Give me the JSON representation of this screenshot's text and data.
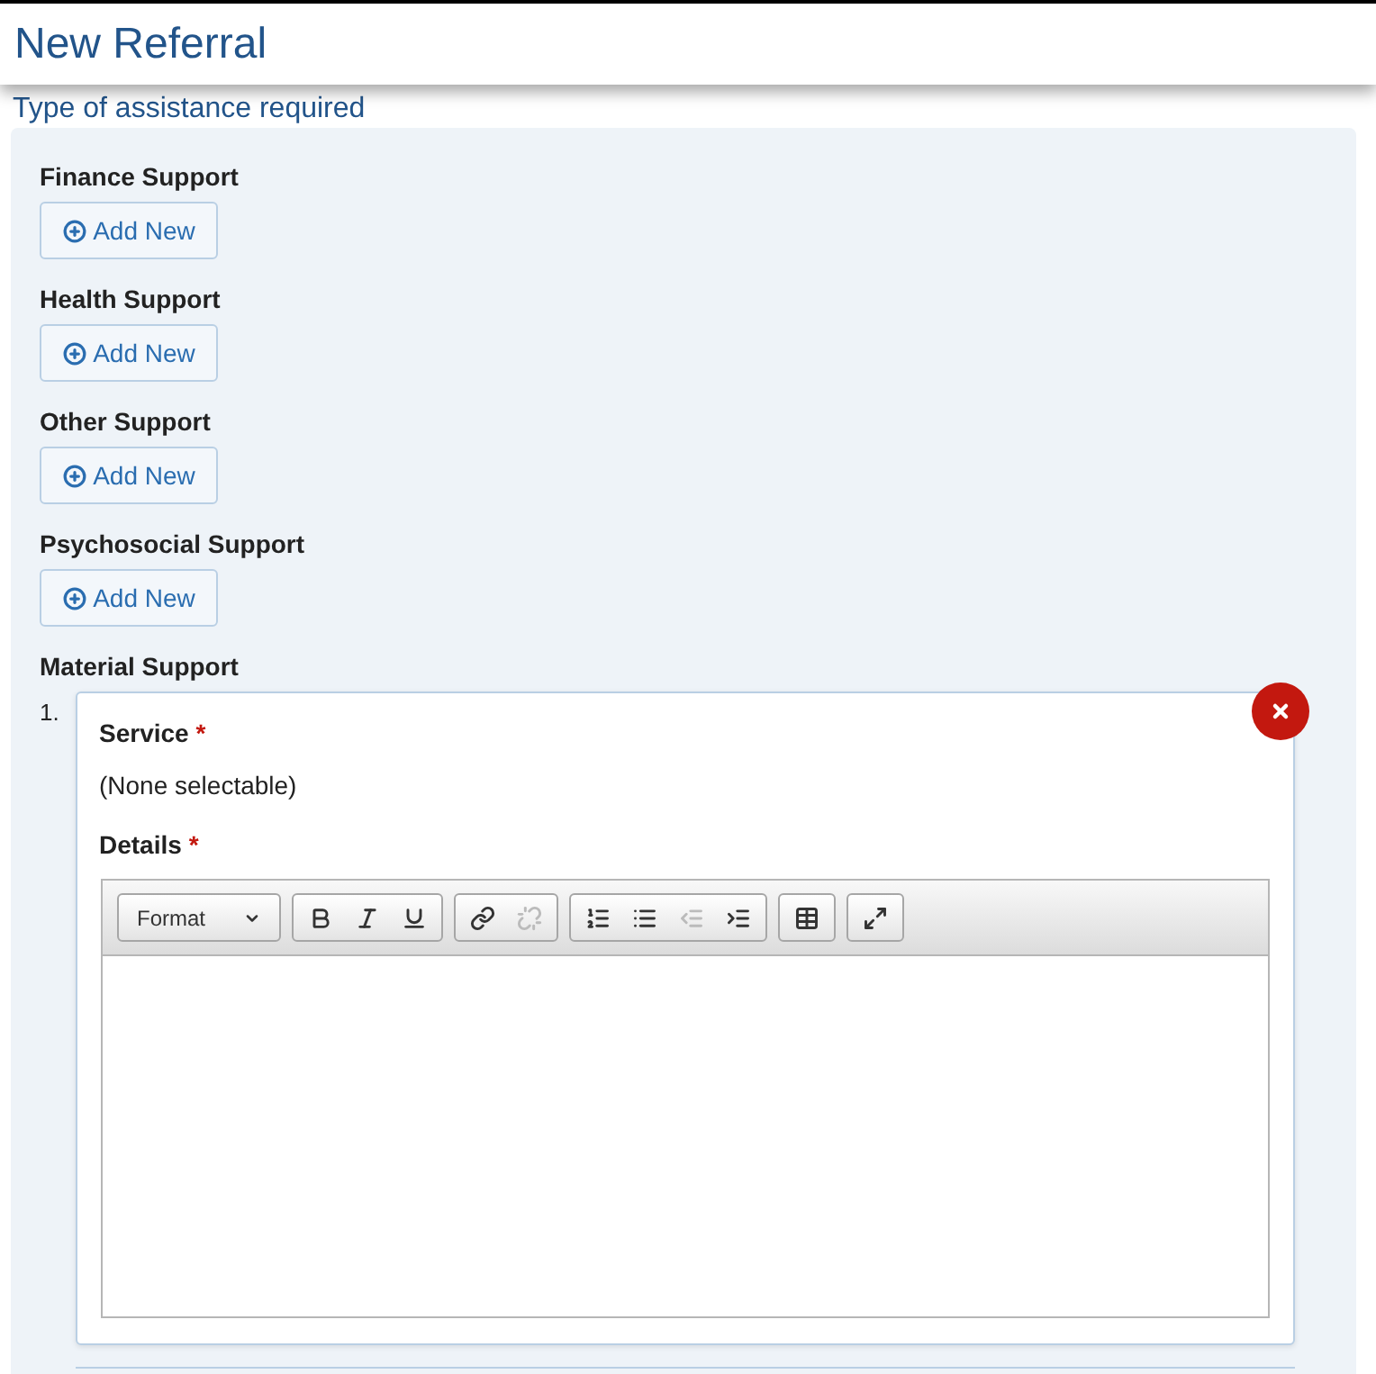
{
  "header": {
    "title": "New Referral"
  },
  "subtitle": "Type of assistance required",
  "sections": [
    {
      "title": "Finance Support",
      "add_button": "Add New"
    },
    {
      "title": "Health Support",
      "add_button": "Add New"
    },
    {
      "title": "Other Support",
      "add_button": "Add New"
    },
    {
      "title": "Psychosocial Support",
      "add_button": "Add New"
    },
    {
      "title": "Material Support",
      "items": [
        {
          "number": "1.",
          "service_label": "Service",
          "service_required": "*",
          "service_value": "(None selectable)",
          "details_label": "Details",
          "details_required": "*",
          "editor": {
            "format_dropdown": "Format",
            "groups": [
              [
                {
                  "kind": "bold",
                  "disabled": false
                },
                {
                  "kind": "italic",
                  "disabled": false
                },
                {
                  "kind": "underline",
                  "disabled": false
                }
              ],
              [
                {
                  "kind": "link",
                  "disabled": false
                },
                {
                  "kind": "unlink",
                  "disabled": true
                }
              ],
              [
                {
                  "kind": "numbered-list",
                  "disabled": false
                },
                {
                  "kind": "bullet-list",
                  "disabled": false
                },
                {
                  "kind": "outdent",
                  "disabled": true
                },
                {
                  "kind": "indent",
                  "disabled": false
                }
              ],
              [
                {
                  "kind": "table",
                  "disabled": false
                }
              ],
              [
                {
                  "kind": "maximize",
                  "disabled": false
                }
              ]
            ]
          }
        }
      ]
    }
  ]
}
